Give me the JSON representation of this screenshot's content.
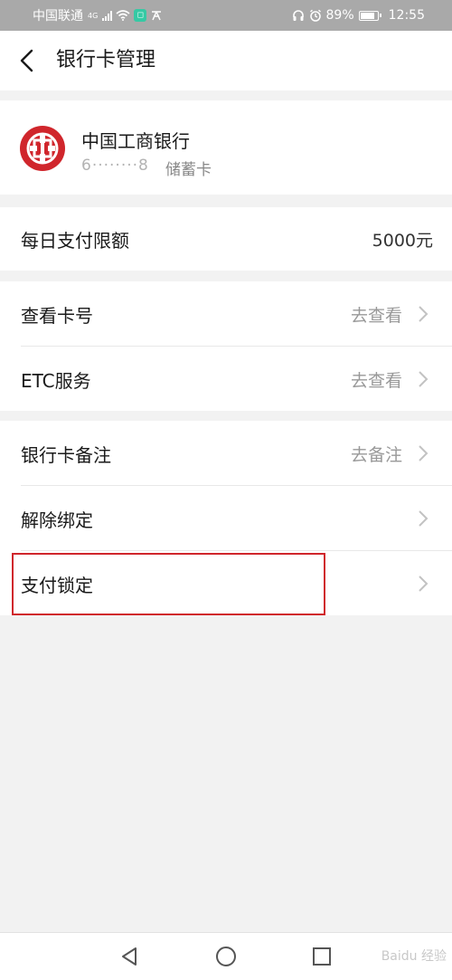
{
  "status_bar": {
    "carrier": "中国联通",
    "network": "4G",
    "battery": "89%",
    "battery_level": 0.89,
    "time": "12:55"
  },
  "header": {
    "title": "银行卡管理"
  },
  "bank_card": {
    "name": "中国工商银行",
    "card_number_masked": "6········8",
    "card_type": "储蓄卡",
    "brand_color": "#d0262c"
  },
  "limit_row": {
    "label": "每日支付限额",
    "value": "5000元"
  },
  "group1": [
    {
      "label": "查看卡号",
      "action": "去查看"
    },
    {
      "label": "ETC服务",
      "action": "去查看"
    }
  ],
  "group2": [
    {
      "label": "银行卡备注",
      "action": "去备注"
    },
    {
      "label": "解除绑定",
      "action": ""
    },
    {
      "label": "支付锁定",
      "action": ""
    }
  ],
  "highlight_color": "#d0262c",
  "watermark": "Baidu 经验"
}
